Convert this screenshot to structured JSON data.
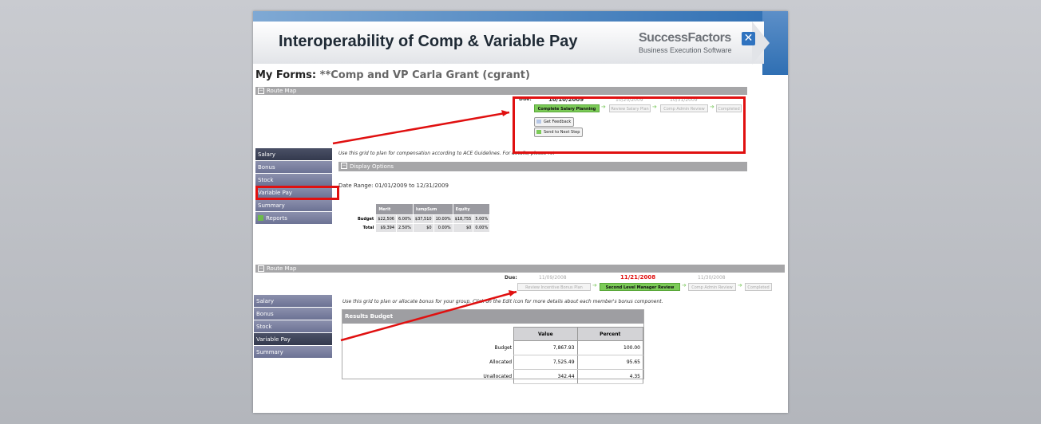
{
  "slide": {
    "title": "Interoperability of Comp & Variable Pay",
    "brand_name": "SuccessFactors",
    "brand_tagline": "Business Execution Software",
    "brand_icon": "x-logo-icon"
  },
  "forms": {
    "label": "My Forms:",
    "form_name": "**Comp and VP Carla Grant (cgrant)"
  },
  "top": {
    "route_map_label": "Route Map",
    "due_label": "Due:",
    "due_dates": [
      "10/10/2009",
      "10/20/2009",
      "10/31/2009"
    ],
    "steps": [
      "Complete Salary Planning",
      "Review Salary Plan",
      "Comp Admin Review",
      "Completed"
    ],
    "buttons": {
      "feedback": "Get Feedback",
      "send": "Send to Next Step"
    },
    "instruction": "Use this grid to plan for compensation according to ACE Guidelines. For details, please refer to the process document.",
    "nav_items": [
      "Salary",
      "Bonus",
      "Stock",
      "Variable Pay",
      "Summary",
      "Reports"
    ],
    "display_options": "Display Options",
    "date_range": "Date Range: 01/01/2009 to 12/31/2009",
    "budget_table": {
      "headers": [
        "Merit",
        "lumpSum",
        "Equity"
      ],
      "rows": [
        {
          "label": "Budget",
          "cells": [
            "$22,506",
            "6.00%",
            "$37,510",
            "10.00%",
            "$18,755",
            "5.00%"
          ]
        },
        {
          "label": "Total",
          "cells": [
            "$9,394",
            "2.50%",
            "$0",
            "0.00%",
            "$0",
            "0.00%"
          ]
        }
      ]
    }
  },
  "bottom": {
    "route_map_label": "Route Map",
    "due_label": "Due:",
    "due_dates": [
      "11/09/2008",
      "11/21/2008",
      "11/30/2008"
    ],
    "steps": [
      "Review Incentive Bonus Plan",
      "Second Level Manager Review",
      "Comp Admin Review",
      "Completed"
    ],
    "instruction": "Use this grid to plan or allocate bonus for your group. Click on the Edit icon for more details about each member's bonus component.",
    "nav_items": [
      "Salary",
      "Bonus",
      "Stock",
      "Variable Pay",
      "Summary"
    ],
    "results": {
      "title": "Results Budget",
      "headers": [
        "Value",
        "Percent"
      ],
      "rows": [
        {
          "label": "Budget",
          "value": "7,867.93",
          "percent": "100.00"
        },
        {
          "label": "Allocated",
          "value": "7,525.49",
          "percent": "95.65"
        },
        {
          "label": "Unallocated",
          "value": "342.44",
          "percent": "4.35"
        }
      ]
    }
  },
  "colors": {
    "highlight": "#e01010",
    "active_step": "#7ccb58",
    "nav": "#6c7294",
    "accent_blue": "#2f6fb3"
  }
}
